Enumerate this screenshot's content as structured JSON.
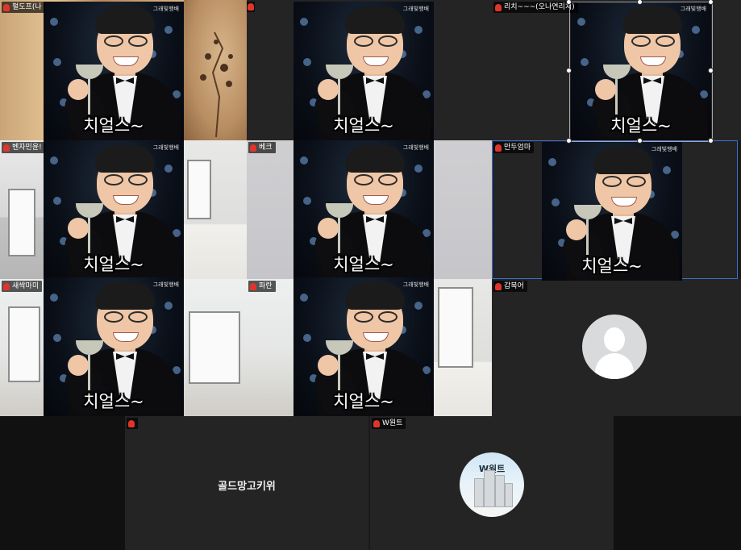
{
  "participants": [
    {
      "id": "p1",
      "name": "펄도프(나"
    },
    {
      "id": "p2",
      "name": ""
    },
    {
      "id": "p3",
      "name": ""
    },
    {
      "id": "p4",
      "name": "리치~~~(오나연리치)"
    },
    {
      "id": "p5",
      "name": "벤자민윤!"
    },
    {
      "id": "p6",
      "name": "베크"
    },
    {
      "id": "p7",
      "name": "만두엄마"
    },
    {
      "id": "p8",
      "name": "새싹마미"
    },
    {
      "id": "p9",
      "name": "파란"
    },
    {
      "id": "p10",
      "name": "갑북어"
    },
    {
      "id": "p11",
      "name": ""
    },
    {
      "id": "p12",
      "name": "W원트"
    }
  ],
  "card": {
    "caption": "치얼스~",
    "watermark": "그래빛행배"
  },
  "tiles": {
    "gold_name": "골드망고키위",
    "w_avatar_text": "W원트"
  },
  "colors": {
    "active_speaker_outline": "#3b6fd1",
    "mic_muted": "#e0352b",
    "tile_bg": "#242424"
  }
}
